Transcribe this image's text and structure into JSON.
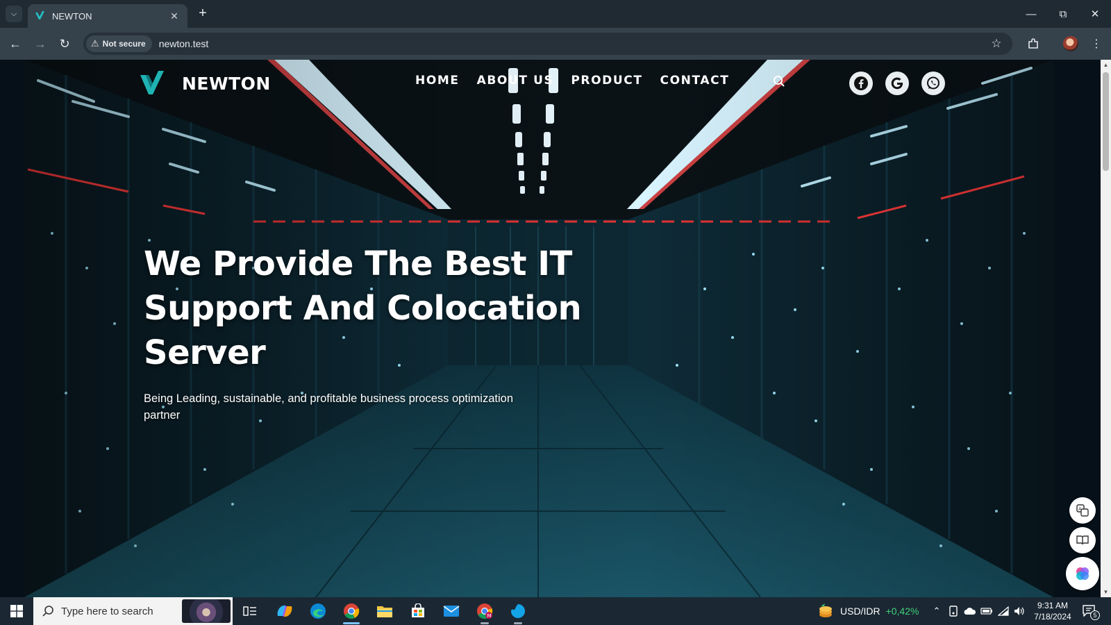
{
  "browser": {
    "tab_title": "NEWTON",
    "security_label": "Not secure",
    "url": "newton.test"
  },
  "site": {
    "brand": "NEWTON",
    "nav": [
      "HOME",
      "ABOUT US",
      "PRODUCT",
      "CONTACT"
    ],
    "social_icons": [
      "facebook-icon",
      "google-icon",
      "whatsapp-icon"
    ],
    "hero_title": "We Provide The Best IT Support And Colocation Server",
    "hero_subtitle": "Being Leading, sustainable, and profitable business process optimization partner",
    "accent_color": "#1fb3b3"
  },
  "taskbar": {
    "search_placeholder": "Type here to search",
    "apps": [
      "task-view-icon",
      "copilot-icon",
      "edge-icon",
      "chrome-icon",
      "file-explorer-icon",
      "microsoft-store-icon",
      "mail-icon",
      "chrome-profile-icon",
      "app-icon"
    ],
    "widget_label": "USD/IDR",
    "widget_change": "+0,42%",
    "time": "9:31 AM",
    "date": "7/18/2024",
    "notification_count": "5"
  }
}
